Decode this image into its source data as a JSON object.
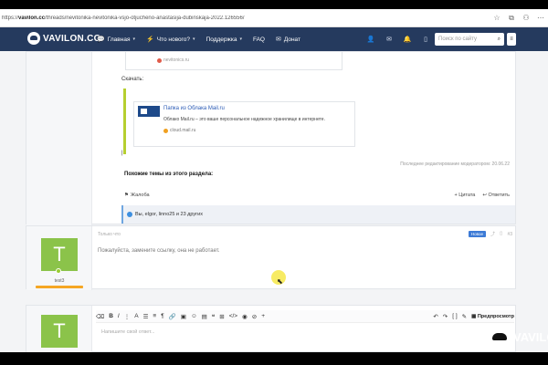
{
  "browser": {
    "url_prefix": "https://",
    "url_domain": "vavilon.cc",
    "url_path": "/threads/nevitonika-nevitonika-vsjo-otjucheno-anastasija-dubinskaja-2022.126556/"
  },
  "nav": {
    "logo": "VAVILON.CC",
    "items": [
      {
        "label": "Главная"
      },
      {
        "label": "Что нового?"
      },
      {
        "label": "Поддержка"
      },
      {
        "label": "FAQ"
      },
      {
        "label": "Донат"
      }
    ],
    "search_placeholder": "Поиск по сайту"
  },
  "post1": {
    "quote_source": "nevitonics.ru",
    "download_label": "Скачать:",
    "link_title": "Папка из Облака Mail.ru",
    "link_desc": "Облако Mail.ru – это ваше персональное надежное хранилище в интернете.",
    "link_domain": "cloud.mail.ru",
    "pipe": "|",
    "last_edited": "Последнее редактирование модератором: 20.06.22",
    "similar_title": "Похожие темы из этого раздела:",
    "report": "Жалоба",
    "quote_btn": "Цитата",
    "reply_btn": "Ответить",
    "reactions": "Вы, elgor, linno25 и 23 других"
  },
  "post2": {
    "time": "Только что",
    "new_badge": "Новое",
    "number": "#3",
    "avatar_letter": "T",
    "username": "test3",
    "text": "Пожалуйста, замените ссылку, она не работает."
  },
  "reply": {
    "avatar_letter": "T",
    "placeholder": "Напишите свой ответ...",
    "preview": "Предпросмотр"
  },
  "watermark": "VAVILON"
}
